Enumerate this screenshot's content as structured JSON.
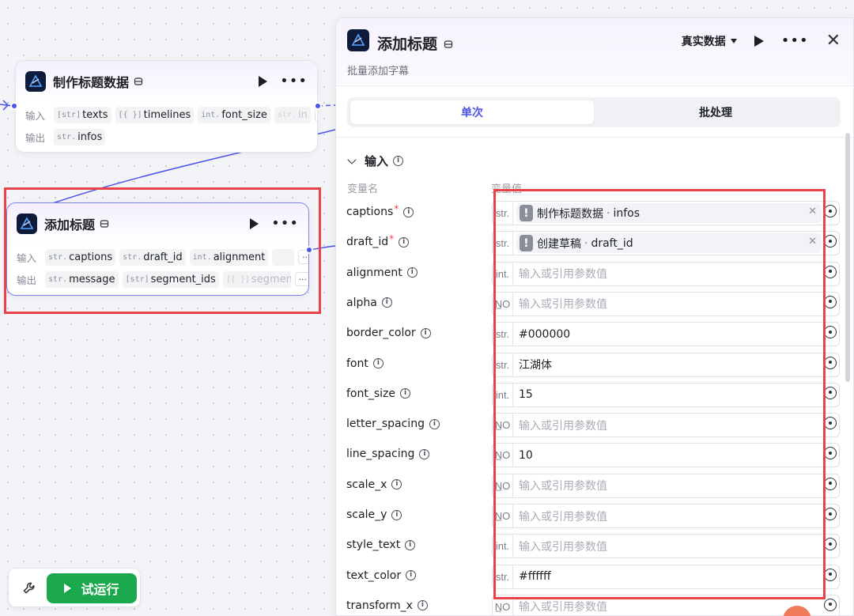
{
  "canvas": {
    "node1": {
      "title": "制作标题数据",
      "input_label": "输入",
      "output_label": "输出",
      "inputs": [
        {
          "type": "[str]",
          "name": "texts"
        },
        {
          "type": "[{ }]",
          "name": "timelines"
        },
        {
          "type": "int.",
          "name": "font_size"
        },
        {
          "type": "str.",
          "name": "in"
        }
      ],
      "outputs": [
        {
          "type": "str.",
          "name": "infos"
        }
      ],
      "more": "···"
    },
    "node2": {
      "title": "添加标题",
      "input_label": "输入",
      "output_label": "输出",
      "inputs": [
        {
          "type": "str.",
          "name": "captions"
        },
        {
          "type": "str.",
          "name": "draft_id"
        },
        {
          "type": "int.",
          "name": "alignment"
        }
      ],
      "outputs": [
        {
          "type": "str.",
          "name": "message"
        },
        {
          "type": "[str]",
          "name": "segment_ids"
        },
        {
          "type": "[{ }]",
          "name": "segment"
        }
      ],
      "more": "···"
    },
    "toolbar": {
      "run_label": "试运行"
    }
  },
  "panel": {
    "title": "添加标题",
    "subtitle": "批量添加字幕",
    "data_mode": "真实数据",
    "tabs": [
      "单次",
      "批处理"
    ],
    "active_tab": "单次",
    "section_title": "输入",
    "col_name": "变量名",
    "col_value": "变量值",
    "placeholder": "输入或引用参数值",
    "params": [
      {
        "name": "captions",
        "required": "*",
        "type": "str.",
        "ref_source": "制作标题数据",
        "ref_field": "infos"
      },
      {
        "name": "draft_id",
        "required": "*",
        "type": "str.",
        "ref_source": "创建草稿",
        "ref_field": "draft_id"
      },
      {
        "name": "alignment",
        "type": "int.",
        "value": ""
      },
      {
        "name": "alpha",
        "type": "N̲O",
        "value": ""
      },
      {
        "name": "border_color",
        "type": "str.",
        "value": "#000000"
      },
      {
        "name": "font",
        "type": "str.",
        "value": "江湖体"
      },
      {
        "name": "font_size",
        "type": "int.",
        "value": "15"
      },
      {
        "name": "letter_spacing",
        "type": "N̲O",
        "value": ""
      },
      {
        "name": "line_spacing",
        "type": "N̲O",
        "value": "10"
      },
      {
        "name": "scale_x",
        "type": "N̲O",
        "value": ""
      },
      {
        "name": "scale_y",
        "type": "N̲O",
        "value": ""
      },
      {
        "name": "style_text",
        "type": "int.",
        "value": ""
      },
      {
        "name": "text_color",
        "type": "str.",
        "value": "#ffffff"
      },
      {
        "name": "transform_x",
        "type": "N̲O",
        "value": ""
      }
    ]
  },
  "colors": {
    "accent": "#4d53e8",
    "highlight": "#e8434a",
    "run": "#1ca84d"
  }
}
